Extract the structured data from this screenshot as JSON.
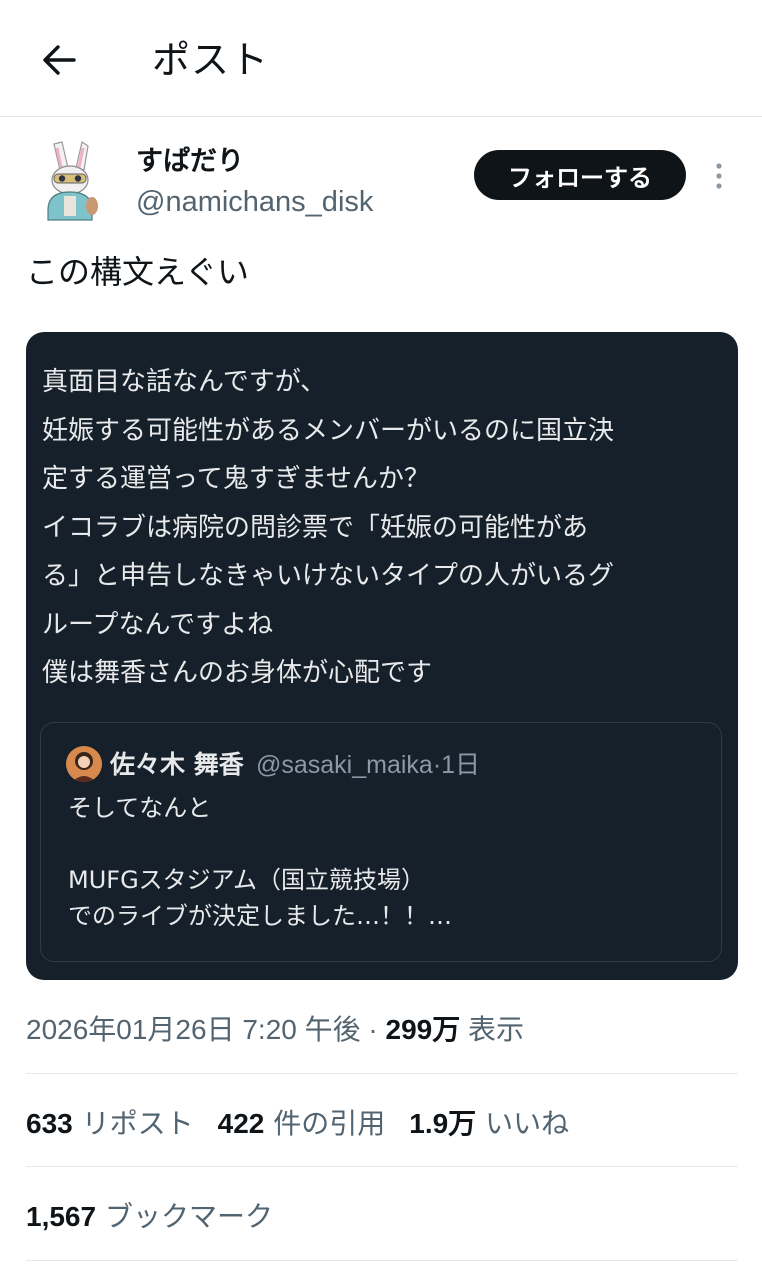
{
  "header": {
    "title": "ポスト",
    "back_icon": "arrow-left-icon"
  },
  "author": {
    "name": "すぱだり",
    "handle": "@namichans_disk",
    "follow_label": "フォローする",
    "more_icon": "more-vertical-icon"
  },
  "post": {
    "text": "この構文えぐい",
    "card_lines": [
      "真面目な話なんですが、",
      "妊娠する可能性があるメンバーがいるのに国立決",
      "定する運営って鬼すぎませんか？",
      "イコラブは病院の問診票で「妊娠の可能性があ",
      "る」と申告しなきゃいけないタイプの人がいるグ",
      "ループなんですよね",
      "僕は舞香さんのお身体が心配です"
    ],
    "quote": {
      "name": "佐々木 舞香",
      "handle_time": "@sasaki_maika·1日",
      "lines": [
        "そしてなんと",
        "",
        "MUFGスタジアム（国立競技場）",
        "でのライブが決定しました…！！…"
      ]
    }
  },
  "meta": {
    "date": "2026年01月26日 7:20 午後 · ",
    "views_count": "299万",
    "views_label": " 表示"
  },
  "stats": {
    "reposts": {
      "count": "633",
      "label": " リポスト"
    },
    "quotes": {
      "count": "422",
      "label": " 件の引用"
    },
    "likes": {
      "count": "1.9万",
      "label": " いいね"
    },
    "bookmarks": {
      "count": "1,567",
      "label": " ブックマーク"
    }
  },
  "colors": {
    "text": "#0f1419",
    "secondary": "#536471",
    "card_bg": "#16202a",
    "card_text": "#e7e9ea",
    "follow_bg": "#0f1419"
  }
}
